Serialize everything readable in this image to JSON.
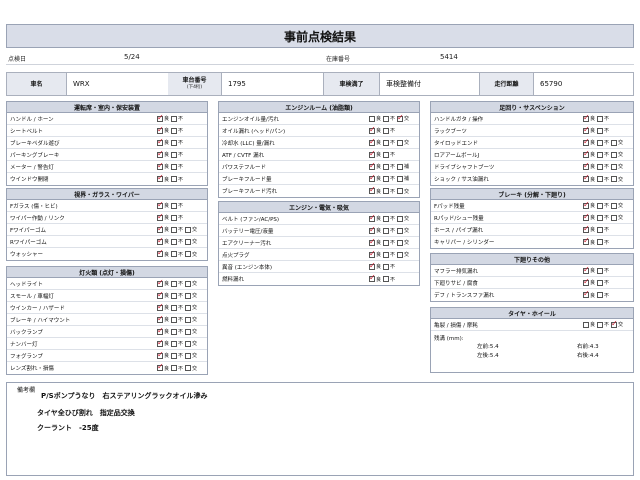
{
  "title": "事前点検結果",
  "header": {
    "inspect_date_label": "点検日",
    "inspect_date_value": "5/24",
    "stock_no_label": "在庫番号",
    "stock_no_value": "5414"
  },
  "vehicle": {
    "name_label": "車名",
    "name_value": "WRX",
    "chassis_label": "車台番号",
    "chassis_sub": "(下4桁)",
    "chassis_value": "1795",
    "inspection_label": "車検満了",
    "inspection_value": "車検整備付",
    "mileage_label": "走行距離",
    "mileage_value": "65790"
  },
  "opt_labels": {
    "good": "良",
    "bad": "不",
    "replace": "交",
    "repair": "補"
  },
  "sections": [
    {
      "title": "運転席・室内・保安装置",
      "items": [
        {
          "label": "ハンドル / ホーン",
          "opts": [
            "good",
            "bad"
          ],
          "checked": "good"
        },
        {
          "label": "シートベルト",
          "opts": [
            "good",
            "bad"
          ],
          "checked": "good"
        },
        {
          "label": "ブレーキペダル遊び",
          "opts": [
            "good",
            "bad"
          ],
          "checked": "good"
        },
        {
          "label": "パーキングブレーキ",
          "opts": [
            "good",
            "bad"
          ],
          "checked": "good"
        },
        {
          "label": "メーター / 警告灯",
          "opts": [
            "good",
            "bad"
          ],
          "checked": "good"
        },
        {
          "label": "ウインドウ開閉",
          "opts": [
            "good",
            "bad"
          ],
          "checked": "good"
        }
      ]
    },
    {
      "title": "視界・ガラス・ワイパー",
      "items": [
        {
          "label": "Fガラス (傷・ヒビ)",
          "opts": [
            "good",
            "bad"
          ],
          "checked": "good"
        },
        {
          "label": "ワイパー作動 / リンク",
          "opts": [
            "good",
            "bad"
          ],
          "checked": "good"
        },
        {
          "label": "Fワイパーゴム",
          "opts": [
            "good",
            "bad",
            "replace"
          ],
          "checked": "good"
        },
        {
          "label": "Rワイパーゴム",
          "opts": [
            "good",
            "bad",
            "replace"
          ],
          "checked": "good"
        },
        {
          "label": "ウォッシャー",
          "opts": [
            "good",
            "bad",
            "replace"
          ],
          "checked": "good"
        }
      ]
    },
    {
      "title": "灯火類 (点灯・損傷)",
      "items": [
        {
          "label": "ヘッドライト",
          "opts": [
            "good",
            "bad",
            "replace"
          ],
          "checked": "good"
        },
        {
          "label": "スモール / 車幅灯",
          "opts": [
            "good",
            "bad",
            "replace"
          ],
          "checked": "good"
        },
        {
          "label": "ウインカー / ハザード",
          "opts": [
            "good",
            "bad",
            "replace"
          ],
          "checked": "good"
        },
        {
          "label": "ブレーキ / ハイマウント",
          "opts": [
            "good",
            "bad",
            "replace"
          ],
          "checked": "good"
        },
        {
          "label": "バックランプ",
          "opts": [
            "good",
            "bad",
            "replace"
          ],
          "checked": "good"
        },
        {
          "label": "ナンバー灯",
          "opts": [
            "good",
            "bad",
            "replace"
          ],
          "checked": "good"
        },
        {
          "label": "フォグランプ",
          "opts": [
            "good",
            "bad",
            "replace"
          ],
          "checked": "good"
        },
        {
          "label": "レンズ割れ・損傷",
          "opts": [
            "good",
            "bad",
            "replace"
          ],
          "checked": "good"
        }
      ]
    },
    {
      "title": "エンジンルーム (油脂類)",
      "items": [
        {
          "label": "エンジンオイル量/汚れ",
          "opts": [
            "good",
            "bad",
            "replace"
          ],
          "checked": "replace"
        },
        {
          "label": "オイル漏れ (ヘッド/パン)",
          "opts": [
            "good",
            "bad"
          ],
          "checked": "good"
        },
        {
          "label": "冷却水 (LLC) 量/漏れ",
          "opts": [
            "good",
            "bad",
            "replace"
          ],
          "checked": "good"
        },
        {
          "label": "ATF / CVTF 漏れ",
          "opts": [
            "good",
            "bad"
          ],
          "checked": "good"
        },
        {
          "label": "パワステフルード",
          "opts": [
            "good",
            "bad",
            "repair"
          ],
          "checked": "good"
        },
        {
          "label": "ブレーキフルード量",
          "opts": [
            "good",
            "bad",
            "repair"
          ],
          "checked": "good"
        },
        {
          "label": "ブレーキフルード汚れ",
          "opts": [
            "good",
            "bad",
            "replace"
          ],
          "checked": "good"
        }
      ]
    },
    {
      "title": "エンジン・電気・吸気",
      "items": [
        {
          "label": "ベルト (ファン/AC/PS)",
          "opts": [
            "good",
            "bad",
            "replace"
          ],
          "checked": "good"
        },
        {
          "label": "バッテリー電圧/液量",
          "opts": [
            "good",
            "bad",
            "replace"
          ],
          "checked": "good"
        },
        {
          "label": "エアクリーナー汚れ",
          "opts": [
            "good",
            "bad",
            "replace"
          ],
          "checked": "good"
        },
        {
          "label": "点火プラグ",
          "opts": [
            "good",
            "bad",
            "replace"
          ],
          "checked": "good"
        },
        {
          "label": "異音 (エンジン本体)",
          "opts": [
            "good",
            "bad"
          ],
          "checked": "good"
        },
        {
          "label": "燃料漏れ",
          "opts": [
            "good",
            "bad"
          ],
          "checked": "good"
        }
      ]
    },
    {
      "title": "足回り・サスペンション",
      "items": [
        {
          "label": "ハンドルガタ / 操作",
          "opts": [
            "good",
            "bad"
          ],
          "checked": "good"
        },
        {
          "label": "ラックブーツ",
          "opts": [
            "good",
            "bad"
          ],
          "checked": "good"
        },
        {
          "label": "タイロッドエンド",
          "opts": [
            "good",
            "bad",
            "replace"
          ],
          "checked": "good"
        },
        {
          "label": "ロアアームボールJ",
          "opts": [
            "good",
            "bad",
            "replace"
          ],
          "checked": "good"
        },
        {
          "label": "ドライブシャフトブーツ",
          "opts": [
            "good",
            "bad",
            "replace"
          ],
          "checked": "good"
        },
        {
          "label": "ショック / サス油漏れ",
          "opts": [
            "good",
            "bad",
            "replace"
          ],
          "checked": "good"
        }
      ]
    },
    {
      "title": "ブレーキ (分解・下廻り)",
      "items": [
        {
          "label": "Fパッド残量",
          "opts": [
            "good",
            "bad",
            "replace"
          ],
          "checked": "good"
        },
        {
          "label": "Rパッド/シュー残量",
          "opts": [
            "good",
            "bad",
            "replace"
          ],
          "checked": "good"
        },
        {
          "label": "ホース / パイプ漏れ",
          "opts": [
            "good",
            "bad"
          ],
          "checked": "good"
        },
        {
          "label": "キャリパー / シリンダー",
          "opts": [
            "good",
            "bad"
          ],
          "checked": "good"
        }
      ]
    },
    {
      "title": "下廻りその他",
      "items": [
        {
          "label": "マフラー排気漏れ",
          "opts": [
            "good",
            "bad"
          ],
          "checked": "good"
        },
        {
          "label": "下廻りサビ / 腐食",
          "opts": [
            "good",
            "bad"
          ],
          "checked": "good"
        },
        {
          "label": "デフ / トランスファ漏れ",
          "opts": [
            "good",
            "bad"
          ],
          "checked": "good"
        }
      ]
    },
    {
      "title": "タイヤ・ホイール",
      "items": [
        {
          "label": "亀裂 / 損傷 / 摩耗",
          "opts": [
            "good",
            "bad",
            "replace"
          ],
          "checked": "replace"
        }
      ]
    }
  ],
  "tread": {
    "label": "残溝 (mm):",
    "fl_label": "左前:",
    "fl": "5.4",
    "fr_label": "右前:",
    "fr": "4.3",
    "rl_label": "左後:",
    "rl": "5.4",
    "rr_label": "右後:",
    "rr": "4.4"
  },
  "remarks": {
    "label": "備考欄",
    "lines": [
      "P/Sポンプうなり　右ステアリングラックオイル滲み",
      "タイヤ全ひび割れ　指定品交換",
      "クーラント　-25度"
    ]
  }
}
